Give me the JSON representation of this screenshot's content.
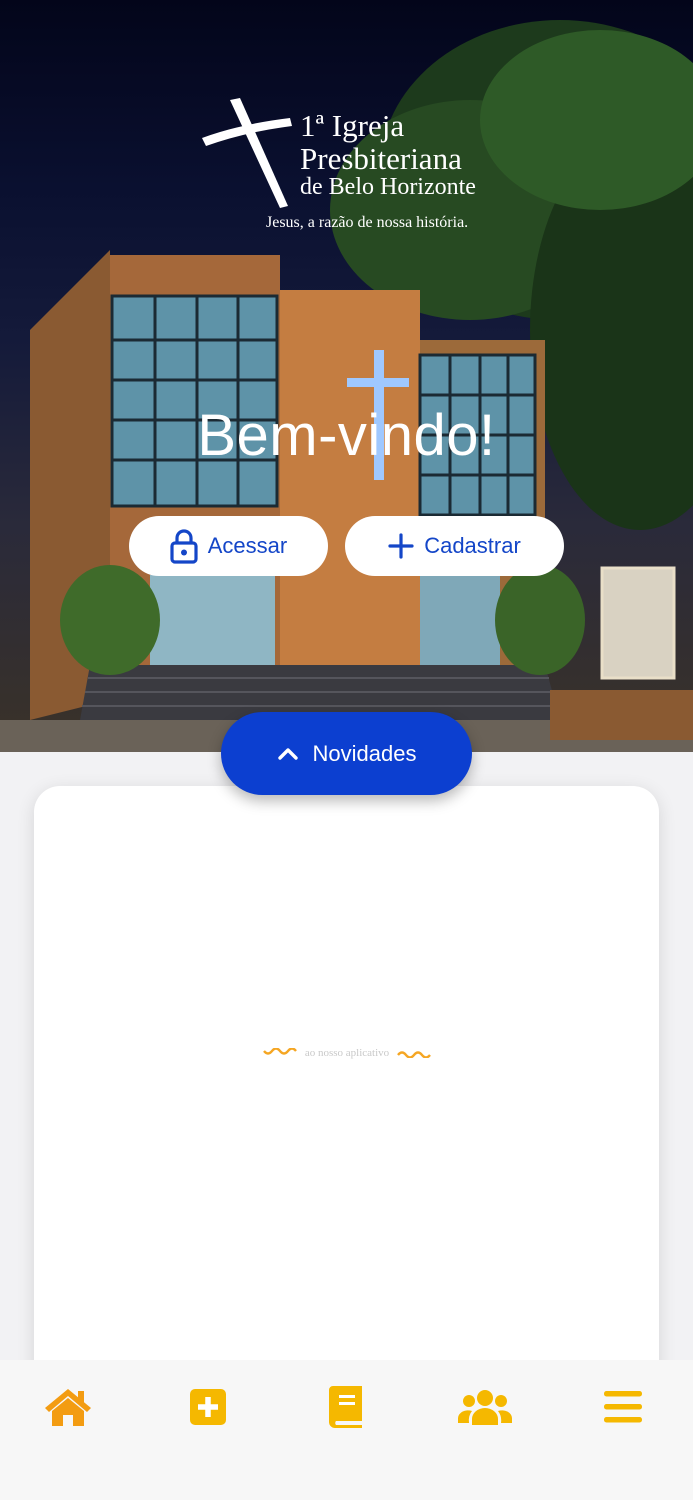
{
  "logo": {
    "line1": "1ª Igreja",
    "line2": "Presbiteriana",
    "line3": "de Belo Horizonte",
    "tagline": "Jesus, a razão de nossa história."
  },
  "hero": {
    "welcome": "Bem-vindo!"
  },
  "actions": {
    "login_label": "Acessar",
    "register_label": "Cadastrar"
  },
  "news": {
    "button_label": "Novidades",
    "faded_text": "ao nosso aplicativo"
  },
  "bottom_nav": {
    "items": [
      {
        "icon": "home-icon"
      },
      {
        "icon": "plus-square-icon"
      },
      {
        "icon": "book-icon"
      },
      {
        "icon": "users-icon"
      },
      {
        "icon": "menu-icon"
      }
    ]
  },
  "colors": {
    "primary_blue": "#0c3fd0",
    "accent_orange": "#f39c12",
    "accent_yellow": "#f5b800"
  }
}
